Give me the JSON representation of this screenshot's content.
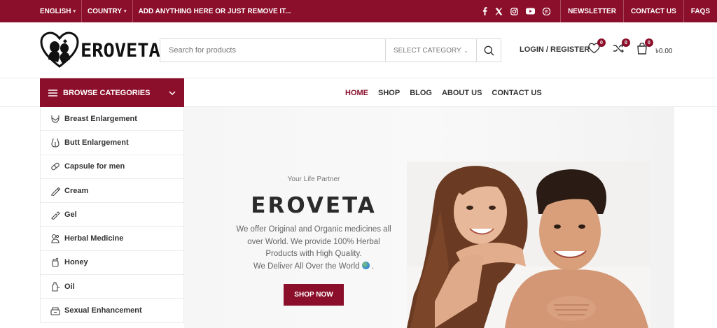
{
  "topbar": {
    "language": "ENGLISH",
    "country": "COUNTRY",
    "promo": "ADD ANYTHING HERE OR JUST REMOVE IT...",
    "social_icons": [
      "facebook-icon",
      "x-icon",
      "instagram-icon",
      "youtube-icon",
      "pinterest-icon"
    ],
    "links": [
      "NEWSLETTER",
      "CONTACT US",
      "FAQS"
    ]
  },
  "header": {
    "logo_text": "EROVETA",
    "search_placeholder": "Search for products",
    "category_select": "SELECT CATEGORY",
    "login": "LOGIN / REGISTER",
    "wishlist_count": "0",
    "compare_count": "0",
    "cart_count": "0",
    "cart_total": "৳0.00"
  },
  "nav": {
    "browse_label": "BROWSE CATEGORIES",
    "items": [
      "HOME",
      "SHOP",
      "BLOG",
      "ABOUT US",
      "CONTACT US"
    ],
    "active": "HOME"
  },
  "categories": [
    "Breast Enlargement",
    "Butt Enlargement",
    "Capsule for men",
    "Cream",
    "Gel",
    "Herbal Medicine",
    "Honey",
    "Oil",
    "Sexual Enhancement"
  ],
  "hero": {
    "tagline": "Your Life Partner",
    "title": "EROVETA",
    "description_1": "We offer Original and Organic medicines all over World. We provide 100% Herbal Products with High Quality.",
    "description_2": "We Deliver All Over the World",
    "cta": "SHOP NOW"
  },
  "colors": {
    "brand": "#8b0f2b"
  }
}
